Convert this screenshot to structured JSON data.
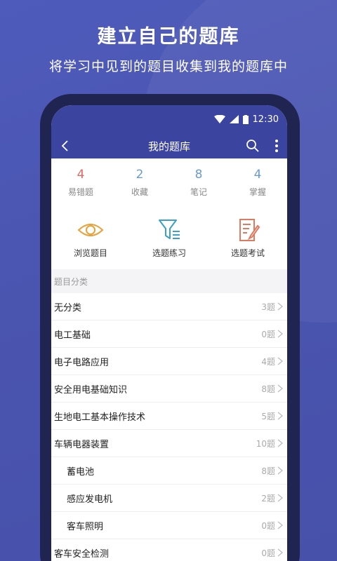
{
  "promo": {
    "headline": "建立自己的题库",
    "subline": "将学习中见到的题目收集到我的题库中"
  },
  "status_bar": {
    "time": "12:30"
  },
  "app_bar": {
    "title": "我的题库"
  },
  "stats": [
    {
      "value": "4",
      "label": "易错题",
      "color": "#e06a60"
    },
    {
      "value": "2",
      "label": "收藏",
      "color": "#6b9bcf"
    },
    {
      "value": "8",
      "label": "笔记",
      "color": "#6b9bcf"
    },
    {
      "value": "4",
      "label": "掌握",
      "color": "#6b9bcf"
    }
  ],
  "actions": [
    {
      "label": "浏览题目",
      "icon": "eye-icon"
    },
    {
      "label": "选题练习",
      "icon": "filter-list-icon"
    },
    {
      "label": "选题考试",
      "icon": "document-edit-icon"
    }
  ],
  "section": {
    "title": "题目分类"
  },
  "categories": [
    {
      "name": "无分类",
      "count": "3题"
    },
    {
      "name": "电工基础",
      "count": "0题"
    },
    {
      "name": "电子电路应用",
      "count": "4题"
    },
    {
      "name": "安全用电基础知识",
      "count": "8题"
    },
    {
      "name": "生地电工基本操作技术",
      "count": "5题"
    },
    {
      "name": "车辆电器装置",
      "count": "10题"
    },
    {
      "name": "蓄电池",
      "count": "8题"
    },
    {
      "name": "感应发电机",
      "count": "2题"
    },
    {
      "name": "客车照明",
      "count": "0题"
    },
    {
      "name": "客车安全检测",
      "count": "0题"
    }
  ]
}
